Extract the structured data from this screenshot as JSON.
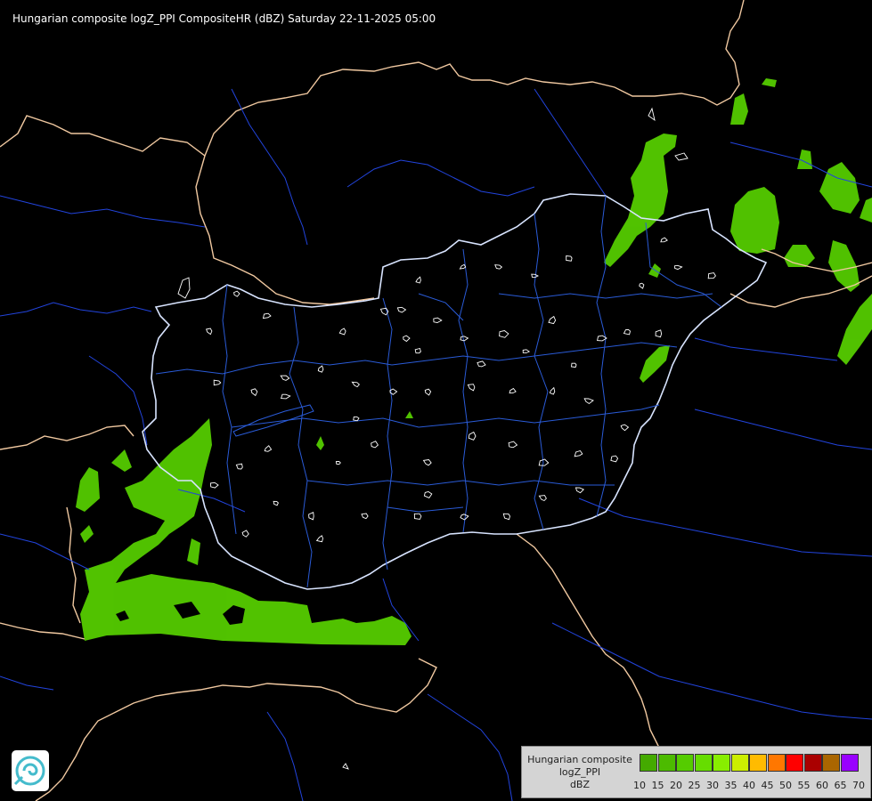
{
  "header": {
    "title": "Hungarian composite logZ_PPI CompositeHR (dBZ) Saturday 22-11-2025 05:00"
  },
  "legend": {
    "lines": [
      "Hungarian composite",
      "logZ_PPI",
      "dBZ"
    ],
    "scale": [
      {
        "value": "10",
        "color": "#44aa00"
      },
      {
        "value": "15",
        "color": "#4cbb00"
      },
      {
        "value": "20",
        "color": "#55cc00"
      },
      {
        "value": "25",
        "color": "#66dd00"
      },
      {
        "value": "30",
        "color": "#88ee00"
      },
      {
        "value": "35",
        "color": "#ccee00"
      },
      {
        "value": "40",
        "color": "#ffbb00"
      },
      {
        "value": "45",
        "color": "#ff7700"
      },
      {
        "value": "50",
        "color": "#ff0000"
      },
      {
        "value": "55",
        "color": "#aa0000"
      },
      {
        "value": "60",
        "color": "#aa6600"
      },
      {
        "value": "65",
        "color": "#9900ff"
      },
      {
        "value": "70",
        "color": "#aabbff"
      }
    ]
  },
  "map_style": {
    "background": "#000000",
    "country_border_color": "#f0c8a0",
    "hungary_border_color": "#ffffff",
    "river_color": "#2244dd",
    "county_border_color": "#2a5bd7",
    "district_outline_color": "#ffffff",
    "echo_color": "#55cc00"
  },
  "logo": {
    "icon": "met-service-swirl-icon"
  }
}
